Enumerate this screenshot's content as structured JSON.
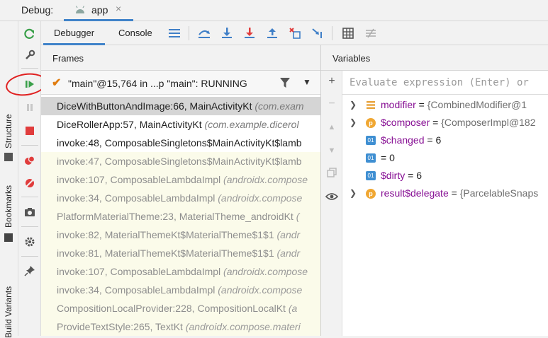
{
  "topbar": {
    "debug_label": "Debug:",
    "app_tab": "app",
    "close": "×"
  },
  "left_strip": {
    "structure": "Structure",
    "bookmarks": "Bookmarks",
    "build_variants": "Build Variants"
  },
  "toolbar": {
    "tabs": [
      "Debugger",
      "Console"
    ]
  },
  "frames": {
    "header": "Frames",
    "thread_selector": "\"main\"@15,764 in ...p \"main\": RUNNING",
    "rows": [
      {
        "method": "DiceWithButtonAndImage:66, MainActivityKt",
        "pkg": "(com.exam"
      },
      {
        "method": "DiceRollerApp:57, MainActivityKt",
        "pkg": "(com.example.dicerol"
      },
      {
        "method": "invoke:48, ComposableSingletons$MainActivityKt$lamb",
        "pkg": ""
      },
      {
        "method": "invoke:47, ComposableSingletons$MainActivityKt$lamb",
        "pkg": ""
      },
      {
        "method": "invoke:107, ComposableLambdaImpl",
        "pkg": "(androidx.compose"
      },
      {
        "method": "invoke:34, ComposableLambdaImpl",
        "pkg": "(androidx.compose"
      },
      {
        "method": "PlatformMaterialTheme:23, MaterialTheme_androidKt",
        "pkg": "("
      },
      {
        "method": "invoke:82, MaterialThemeKt$MaterialTheme$1$1",
        "pkg": "(andr"
      },
      {
        "method": "invoke:81, MaterialThemeKt$MaterialTheme$1$1",
        "pkg": "(andr"
      },
      {
        "method": "invoke:107, ComposableLambdaImpl",
        "pkg": "(androidx.compose"
      },
      {
        "method": "invoke:34, ComposableLambdaImpl",
        "pkg": "(androidx.compose"
      },
      {
        "method": "CompositionLocalProvider:228, CompositionLocalKt",
        "pkg": "(a"
      },
      {
        "method": "ProvideTextStyle:265, TextKt",
        "pkg": "(androidx.compose.materi"
      }
    ]
  },
  "variables": {
    "header": "Variables",
    "eval_placeholder": "Evaluate expression (Enter) or",
    "rows": [
      {
        "name": "modifier",
        "eq": " = ",
        "value": "{CombinedModifier@1"
      },
      {
        "name": "$composer",
        "eq": " = ",
        "value": "{ComposerImpl@182"
      },
      {
        "name": "$changed",
        "eq": " = ",
        "value": "6"
      },
      {
        "name": "",
        "eq": " = ",
        "value": "0"
      },
      {
        "name": "$dirty",
        "eq": " = ",
        "value": "6"
      },
      {
        "name": "result$delegate",
        "eq": " = ",
        "value": "{ParcelableSnaps"
      }
    ]
  },
  "badges": {
    "p": "p",
    "o": "01"
  },
  "colors": {
    "accent": "#4083c9",
    "resume_green": "#3aa04a",
    "stop_red": "#e03c3c",
    "annotation_red": "#e02020"
  }
}
